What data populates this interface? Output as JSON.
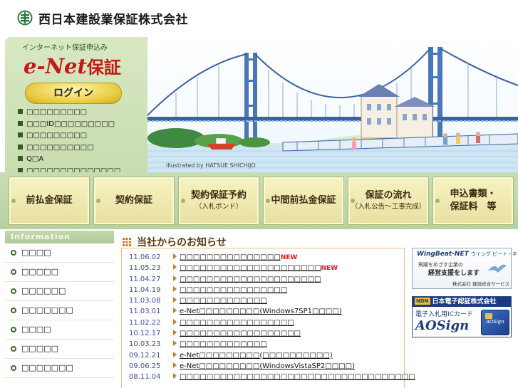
{
  "header": {
    "company_name": "西日本建設業保証株式会社",
    "logo_icon": "company-logo-mark"
  },
  "enet": {
    "subtitle": "インターネット保証申込み",
    "logo_text": "e-Net",
    "logo_suffix": "保証",
    "login_label": "ログイン",
    "links": [
      "□□□□□□□□□",
      "□□□ID□□□□□□□□□",
      "□□□□□□□□□",
      "□□□□□□□□□□",
      "Q□A",
      "□□□□□□□□□□□□□□"
    ]
  },
  "hero": {
    "credit": "illustrated by HATSUE SHICHIJO"
  },
  "nav": {
    "items": [
      {
        "line1": "前払金保証",
        "line2": ""
      },
      {
        "line1": "契約保証",
        "line2": ""
      },
      {
        "line1": "契約保証予約",
        "line2": "（入札ボンド）"
      },
      {
        "line1": "中間前払金保証",
        "line2": ""
      },
      {
        "line1": "保証の流れ",
        "line2": "（入札公告～工事完成）"
      },
      {
        "line1": "申込書類・",
        "line2": "保証料　等"
      }
    ]
  },
  "information": {
    "header": "Information",
    "items": [
      "□□□□",
      "□□□□□",
      "□□□□□□",
      "□□□□□□□",
      "□□□□",
      "□□□□□",
      "□□□□□□□"
    ]
  },
  "news": {
    "title": "当社からのお知らせ",
    "items": [
      {
        "date": "11.06.02",
        "title": "□□□□□□□□□□□□□□□",
        "new": "NEW"
      },
      {
        "date": "11.05.23",
        "title": "□□□□□□□□□□□□□□□□□□□□□",
        "new": "NEW"
      },
      {
        "date": "11.04.27",
        "title": "□□□□□□□□□□□□□□□□□□□□□",
        "new": ""
      },
      {
        "date": "11.04.19",
        "title": "□□□□□□□□□□□□□□□□",
        "new": ""
      },
      {
        "date": "11.03.08",
        "title": "□□□□□□□□□□□□□",
        "new": ""
      },
      {
        "date": "11.03.01",
        "title": "e-Net□□□□□□□□□(Windows7SP1□□□□)",
        "new": ""
      },
      {
        "date": "11.02.22",
        "title": "□□□□□□□□□□□□□□□□□",
        "new": ""
      },
      {
        "date": "10.12.17",
        "title": "□□□□□□□□□□□□□□□□□□",
        "new": ""
      },
      {
        "date": "10.03.23",
        "title": "□□□□□□□□□□□□□",
        "new": ""
      },
      {
        "date": "09.12.21",
        "title": "e-Net□□□□□□□□□(□□□□□□□□□□)",
        "new": ""
      },
      {
        "date": "09.06.25",
        "title": "e-Net□□□□□□□□□(WindowsVistaSP2□□□□)",
        "new": ""
      },
      {
        "date": "08.11.04",
        "title": "□□□□□□□□□□□□□□□□□□□□□□□□□□□□□□□□□□□",
        "new": ""
      }
    ]
  },
  "banners": {
    "wingbeat": {
      "title": "WingBeat-NET",
      "title_kana": "ウイング ビート・ネット",
      "line1": "飛躍をめざす企業の",
      "line2": "経営支援をします",
      "company": "株式会社 建設総合サービス"
    },
    "aosign": {
      "company": "日本電子認証株式会社",
      "badge": "NDN",
      "card_label": "電子入札用ICカード",
      "logo": "AOSign",
      "card_text": "AOSign"
    }
  },
  "colors": {
    "brand_green": "#2d5e1e",
    "enet_red": "#c21818",
    "news_date": "#3a4fa0",
    "new_badge": "#e01818",
    "nav_button": "#f7f2c2"
  }
}
